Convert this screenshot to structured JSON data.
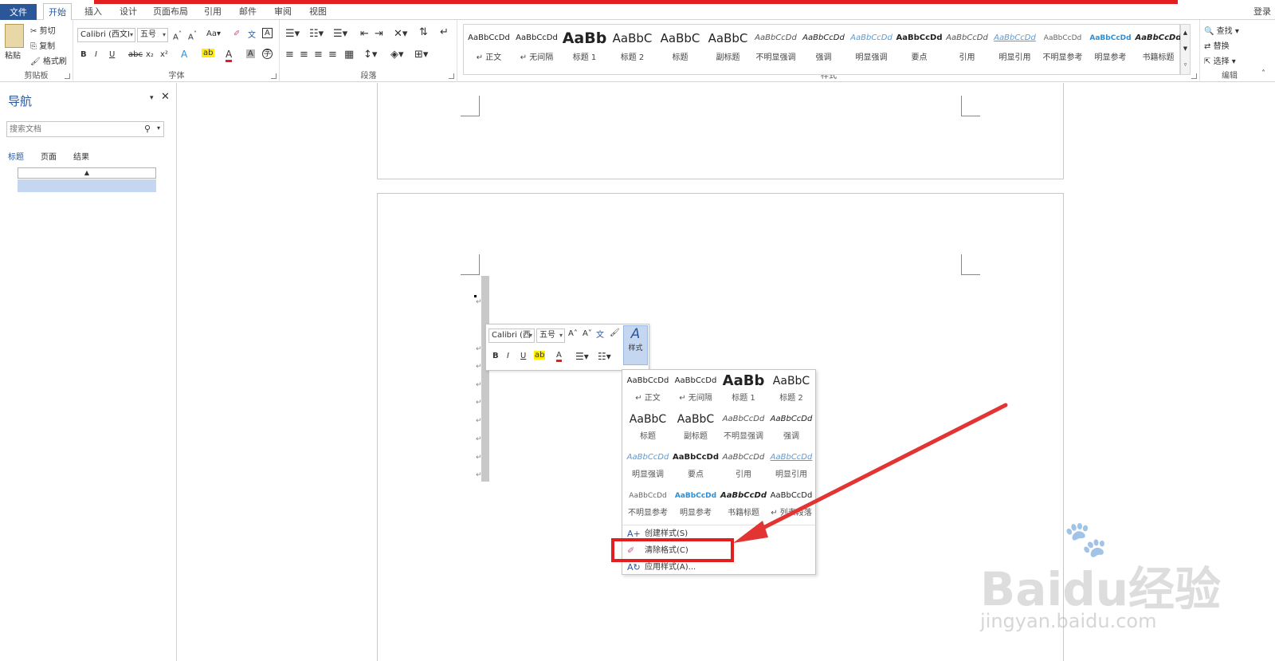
{
  "tabs": [
    "文件",
    "开始",
    "插入",
    "设计",
    "页面布局",
    "引用",
    "邮件",
    "审阅",
    "视图"
  ],
  "login": "登录",
  "clipboard": {
    "paste": "粘贴",
    "cut": "剪切",
    "copy": "复制",
    "format_painter": "格式刷",
    "label": "剪贴板"
  },
  "font": {
    "name": "Calibri (西文I",
    "size": "五号",
    "change_case": "Aa",
    "bold": "B",
    "italic": "I",
    "underline": "U",
    "strike": "abc",
    "sub": "x₂",
    "sup": "x²",
    "label": "字体"
  },
  "paragraph": {
    "label": "段落"
  },
  "styles": {
    "label": "样式",
    "items": [
      {
        "preview": "AaBbCcDd",
        "name": "↵ 正文"
      },
      {
        "preview": "AaBbCcDd",
        "name": "↵ 无间隔"
      },
      {
        "preview": "AaBb",
        "name": "标题 1"
      },
      {
        "preview": "AaBbC",
        "name": "标题 2"
      },
      {
        "preview": "AaBbC",
        "name": "标题"
      },
      {
        "preview": "AaBbC",
        "name": "副标题"
      },
      {
        "preview": "AaBbCcDd",
        "name": "不明显强调"
      },
      {
        "preview": "AaBbCcDd",
        "name": "强调"
      },
      {
        "preview": "AaBbCcDd",
        "name": "明显强调"
      },
      {
        "preview": "AaBbCcDd",
        "name": "要点"
      },
      {
        "preview": "AaBbCcDd",
        "name": "引用"
      },
      {
        "preview": "AaBbCcDd",
        "name": "明显引用"
      },
      {
        "preview": "AaBbCcDd",
        "name": "不明显参考"
      },
      {
        "preview": "AaBbCcDd",
        "name": "明显参考"
      },
      {
        "preview": "AaBbCcDd",
        "name": "书籍标题"
      }
    ]
  },
  "editing": {
    "find": "查找",
    "replace": "替换",
    "select": "选择",
    "label": "编辑"
  },
  "navpane": {
    "title": "导航",
    "search_placeholder": "搜索文档",
    "tabs": [
      "标题",
      "页面",
      "结果"
    ]
  },
  "mini_toolbar": {
    "font": "Calibri (西",
    "size": "五号",
    "styles": "样式",
    "bold": "B",
    "italic": "I",
    "underline": "U"
  },
  "style_menu": {
    "items": [
      {
        "preview": "AaBbCcDd",
        "name": "↵ 正文"
      },
      {
        "preview": "AaBbCcDd",
        "name": "↵ 无间隔"
      },
      {
        "preview": "AaBb",
        "name": "标题 1"
      },
      {
        "preview": "AaBbC",
        "name": "标题 2"
      },
      {
        "preview": "AaBbC",
        "name": "标题"
      },
      {
        "preview": "AaBbC",
        "name": "副标题"
      },
      {
        "preview": "AaBbCcDd",
        "name": "不明显强调"
      },
      {
        "preview": "AaBbCcDd",
        "name": "强调"
      },
      {
        "preview": "AaBbCcDd",
        "name": "明显强调"
      },
      {
        "preview": "AaBbCcDd",
        "name": "要点"
      },
      {
        "preview": "AaBbCcDd",
        "name": "引用"
      },
      {
        "preview": "AaBbCcDd",
        "name": "明显引用"
      },
      {
        "preview": "AaBbCcDd",
        "name": "不明显参考"
      },
      {
        "preview": "AaBbCcDd",
        "name": "明显参考"
      },
      {
        "preview": "AaBbCcDd",
        "name": "书籍标题"
      },
      {
        "preview": "AaBbCcDd",
        "name": "↵ 列表段落"
      }
    ],
    "commands": [
      {
        "label": "创建样式(S)"
      },
      {
        "label": "清除格式(C)"
      },
      {
        "label": "应用样式(A)..."
      }
    ]
  },
  "watermark": {
    "brand": "Baidu经验",
    "url": "jingyan.baidu.com"
  },
  "colors": {
    "accent": "#2b579a",
    "highlight": "#e31e1e",
    "selection": "#c5d7f0"
  }
}
